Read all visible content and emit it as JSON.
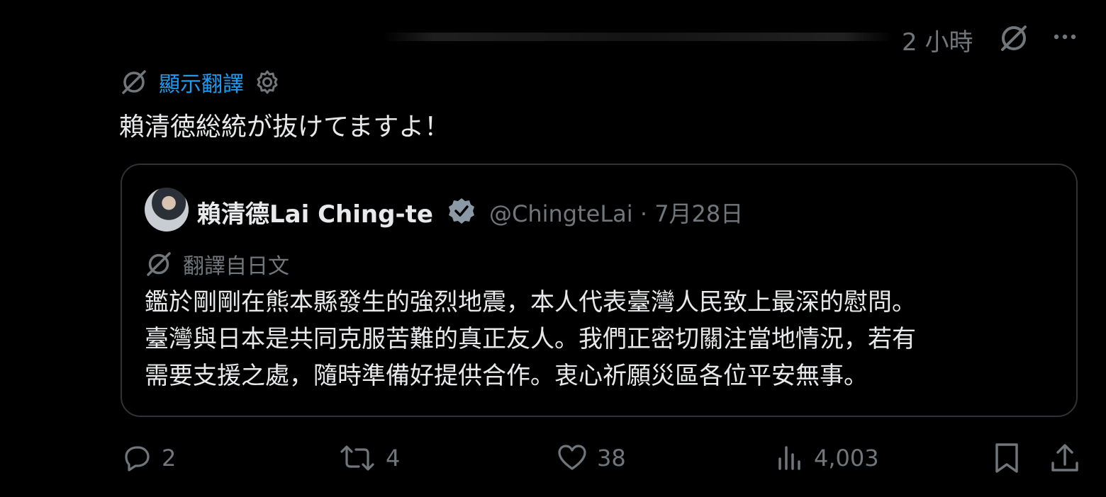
{
  "header": {
    "time": "2 小時",
    "grok_icon": "grok-icon",
    "more_icon": "more-horizontal-icon"
  },
  "tweet": {
    "translate_label": "顯示翻譯",
    "text": "賴清徳総統が抜けてますよ！"
  },
  "quote": {
    "display_name": "賴清德Lai Ching-te",
    "handle_date": "@ChingteLai · 7月28日",
    "translated_label": "翻譯自日文",
    "body_lines": [
      "鑑於剛剛在熊本縣發生的強烈地震，本人代表臺灣人民致上最深的慰問。",
      "臺灣與日本是共同克服苦難的真正友人。我們正密切關注當地情況，若有",
      "需要支援之處，隨時準備好提供合作。衷心祈願災區各位平安無事。"
    ]
  },
  "actions": {
    "replies": "2",
    "reposts": "4",
    "likes": "38",
    "views": "4,003"
  },
  "colors": {
    "background": "#000000",
    "text": "#e7e9ea",
    "secondary": "#71767b",
    "accent": "#1d9bf0",
    "border": "#2f3336",
    "verified": "#8b98a5"
  }
}
